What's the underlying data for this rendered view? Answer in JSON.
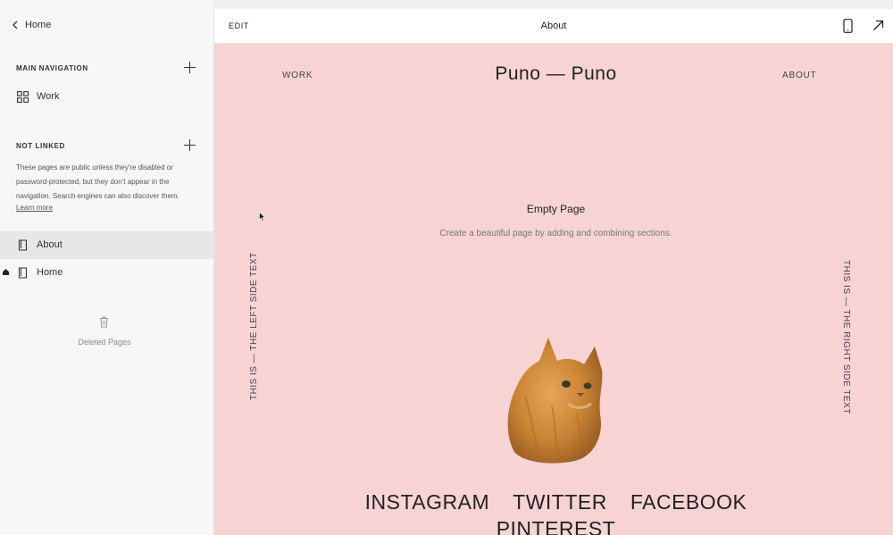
{
  "sidebar": {
    "back_label": "Home",
    "main_nav_header": "MAIN NAVIGATION",
    "main_nav_items": [
      {
        "label": "Work",
        "icon": "grid-icon"
      }
    ],
    "not_linked_header": "NOT LINKED",
    "not_linked_desc": "These pages are public unless they're disabled or password-protected, but they don't appear in the navigation. Search engines can also discover them.",
    "learn_more": "Learn more",
    "not_linked_items": [
      {
        "label": "About",
        "icon": "page-icon",
        "selected": true
      },
      {
        "label": "Home",
        "icon": "page-icon",
        "homepage": true
      }
    ],
    "deleted_pages": "Deleted Pages"
  },
  "topbar": {
    "edit_label": "EDIT",
    "title": "About"
  },
  "site": {
    "nav_left": "WORK",
    "title": "Puno — Puno",
    "nav_right": "ABOUT",
    "empty_title": "Empty Page",
    "empty_subtitle": "Create a beautiful page by adding and combining sections.",
    "left_side_text": "THIS IS — THE LEFT SIDE TEXT",
    "right_side_text": "THIS IS — THE RIGHT SIDE TEXT",
    "social": [
      "INSTAGRAM",
      "TWITTER",
      "FACEBOOK"
    ],
    "social_row2": "PINTEREST"
  },
  "colors": {
    "canvas_bg": "#f7d3d3",
    "sidebar_bg": "#f7f7f7",
    "selected_bg": "#e7e7e7"
  }
}
